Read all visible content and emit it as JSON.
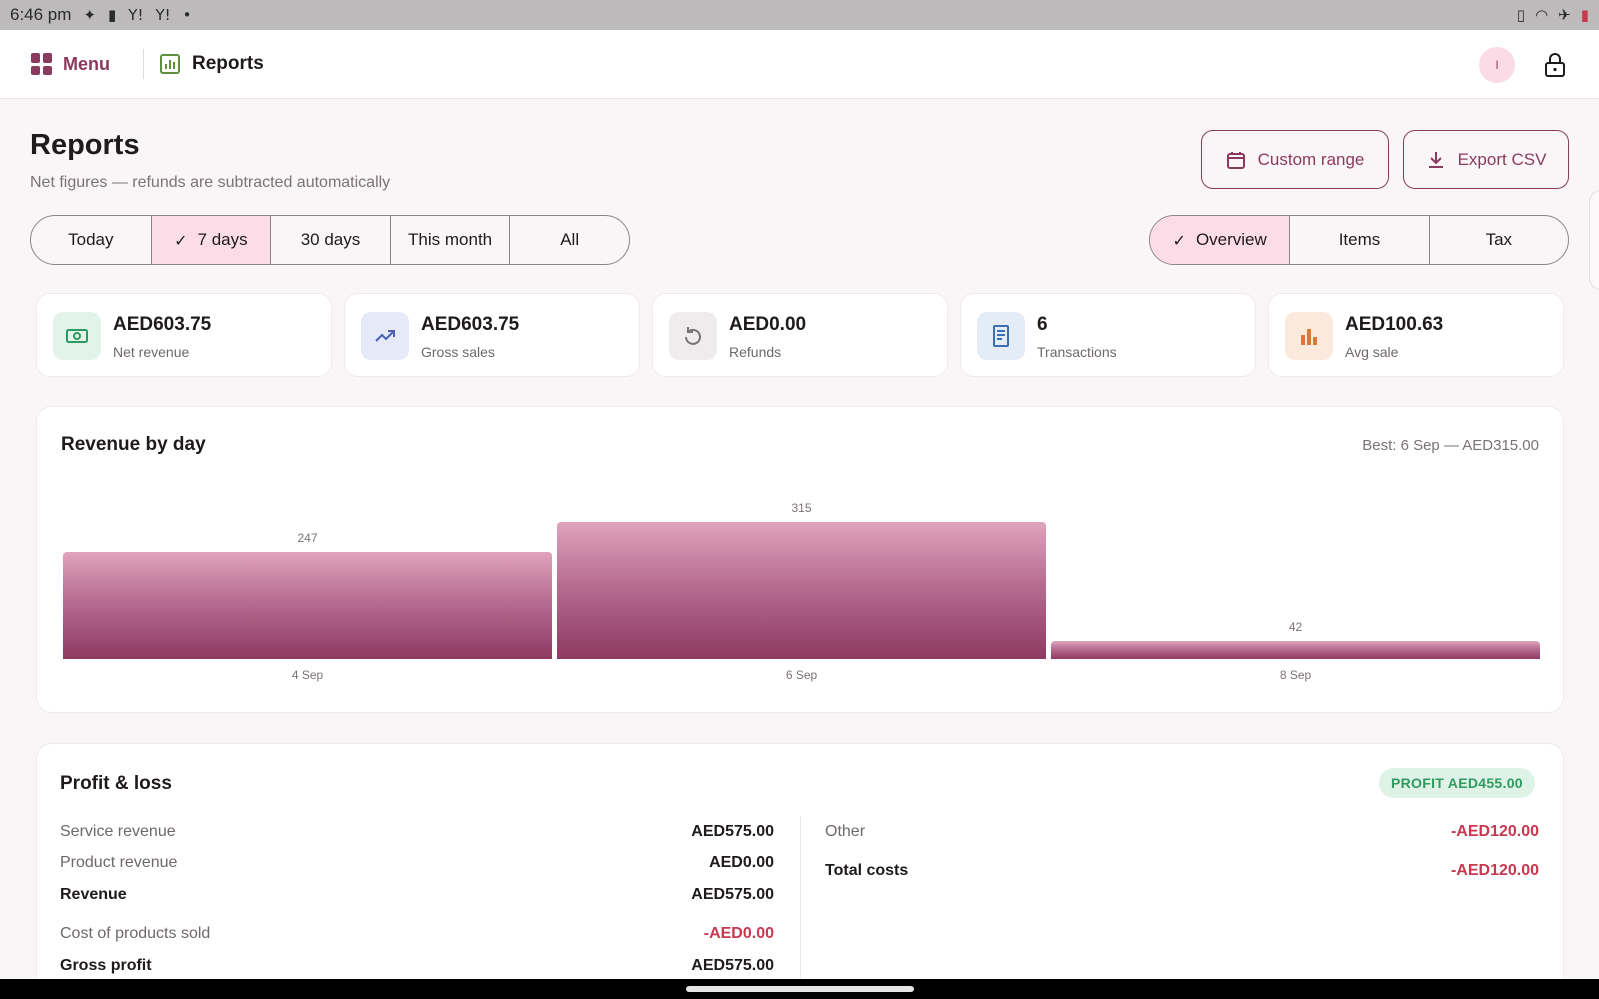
{
  "status_bar": {
    "time": "6:46 pm",
    "icons": [
      "sparkle-icon",
      "battery-alert-icon",
      "yahoo-icon",
      "yahoo-icon",
      "dot-icon",
      "vibrate-icon",
      "wifi-icon",
      "airplane-icon",
      "battery-icon"
    ]
  },
  "app_bar": {
    "menu_label": "Menu",
    "section_label": "Reports",
    "avatar_initial": "I"
  },
  "header": {
    "title": "Reports",
    "subtitle": "Net figures — refunds are subtracted automatically"
  },
  "actions": {
    "custom_range": "Custom range",
    "export_csv": "Export CSV"
  },
  "range_filter": {
    "options": [
      "Today",
      "7 days",
      "30 days",
      "This month",
      "All"
    ],
    "selected": "7 days"
  },
  "view_tabs": {
    "options": [
      "Overview",
      "Items",
      "Tax"
    ],
    "selected": "Overview"
  },
  "stats": [
    {
      "value": "AED603.75",
      "label": "Net revenue",
      "icon": "cash-icon",
      "color": "#2f9a5f",
      "bg": "#e2f3e9"
    },
    {
      "value": "AED603.75",
      "label": "Gross sales",
      "icon": "trending-up-icon",
      "color": "#4a5fb5",
      "bg": "#e6e9f7"
    },
    {
      "value": "AED0.00",
      "label": "Refunds",
      "icon": "undo-icon",
      "color": "#7a7275",
      "bg": "#efeced"
    },
    {
      "value": "6",
      "label": "Transactions",
      "icon": "receipt-icon",
      "color": "#3a6fb5",
      "bg": "#e3ecf7"
    },
    {
      "value": "AED100.63",
      "label": "Avg sale",
      "icon": "bar-chart-icon",
      "color": "#d9763a",
      "bg": "#fbe9de"
    }
  ],
  "revenue_card": {
    "title": "Revenue by day",
    "best_note": "Best: 6 Sep — AED315.00"
  },
  "chart_data": {
    "type": "bar",
    "title": "Revenue by day",
    "categories": [
      "4 Sep",
      "6 Sep",
      "8 Sep"
    ],
    "values": [
      247,
      315,
      42
    ],
    "data_labels": [
      "247",
      "315",
      "42"
    ],
    "ylim": [
      0,
      315
    ],
    "grid": false,
    "colors": {
      "top": "#e0a3bd",
      "bottom": "#8f3a62"
    }
  },
  "pnl": {
    "title": "Profit & loss",
    "badge": "PROFIT AED455.00",
    "left": [
      {
        "label": "Service revenue",
        "amount": "AED575.00",
        "bold": false,
        "negative": false
      },
      {
        "label": "Product revenue",
        "amount": "AED0.00",
        "bold": false,
        "negative": false
      },
      {
        "label": "Revenue",
        "amount": "AED575.00",
        "bold": true,
        "negative": false
      },
      {
        "label": "Cost of products sold",
        "amount": "-AED0.00",
        "bold": false,
        "negative": true
      },
      {
        "label": "Gross profit",
        "amount": "AED575.00",
        "bold": true,
        "negative": false
      }
    ],
    "right": [
      {
        "label": "Other",
        "amount": "-AED120.00",
        "bold": false,
        "negative": true
      },
      {
        "label": "Total costs",
        "amount": "-AED120.00",
        "bold": true,
        "negative": true
      }
    ]
  },
  "colors": {
    "accent": "#8a3a5e",
    "selected_bg": "#fcdde7",
    "profit": "#2f9a5f",
    "loss": "#c8384f"
  }
}
